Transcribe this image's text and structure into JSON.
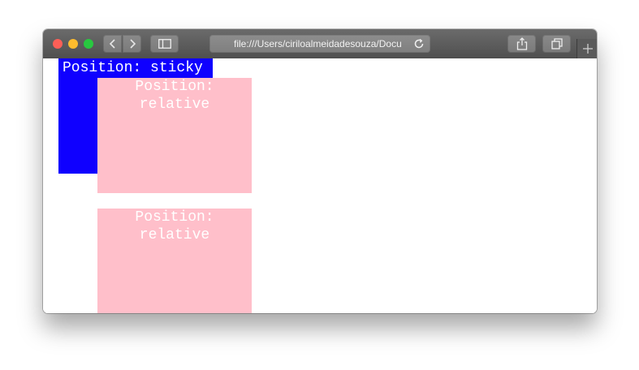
{
  "toolbar": {
    "address_url": "file:///Users/ciriloalmeidadesouza/Docu",
    "back_icon": "chevron-left-icon",
    "forward_icon": "chevron-right-icon",
    "sidebar_icon": "sidebar-icon",
    "share_icon": "share-icon",
    "tabs_icon": "tabs-overview-icon",
    "reload_icon": "reload-icon",
    "new_tab_icon": "plus-icon"
  },
  "content": {
    "sticky_label": "Position: sticky",
    "relative_boxes": [
      {
        "label": "Position:\nrelative"
      },
      {
        "label": "Position:\nrelative"
      }
    ],
    "colors": {
      "sticky_bg": "#0f00ff",
      "relative_bg": "#ffbfca"
    }
  }
}
